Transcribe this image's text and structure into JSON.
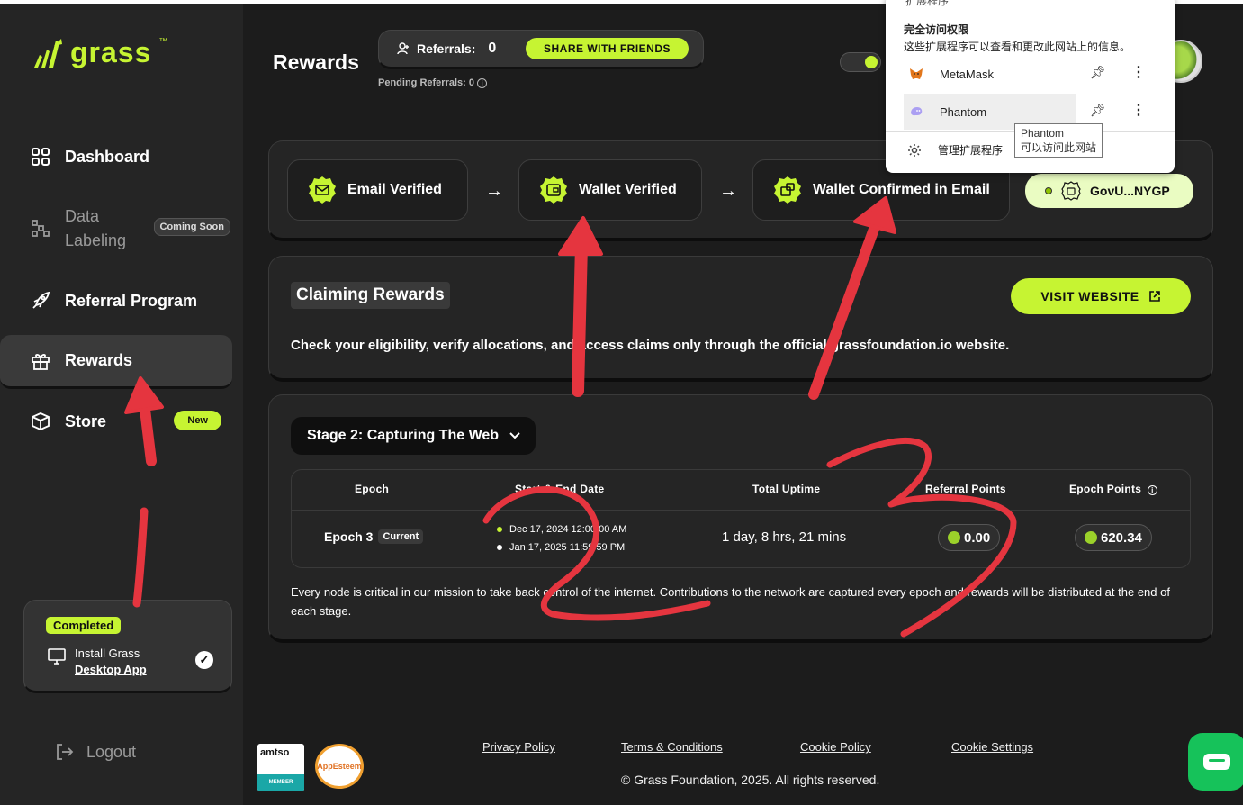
{
  "sidebar": {
    "logo_text": "grass",
    "logo_tm": "™",
    "items": [
      {
        "label": "Dashboard"
      },
      {
        "label_line1": "Data",
        "label_line2": "Labeling",
        "badge": "Coming Soon"
      },
      {
        "label": "Referral Program"
      },
      {
        "label": "Rewards"
      },
      {
        "label": "Store",
        "badge": "New"
      }
    ],
    "completed": {
      "badge": "Completed",
      "line1": "Install Grass",
      "link": "Desktop App",
      "check": "✓"
    },
    "logout": "Logout"
  },
  "header": {
    "title": "Rewards",
    "referrals_label": "Referrals:",
    "referrals_count": "0",
    "share_button": "SHARE WITH FRIENDS",
    "pending_label": "Pending Referrals:",
    "pending_count": "0"
  },
  "verification": {
    "steps": [
      "Email Verified",
      "Wallet Verified",
      "Wallet Confirmed in Email"
    ],
    "arrow": "→",
    "wallet": "GovU...NYGP"
  },
  "claiming": {
    "title": "Claiming Rewards",
    "button": "VISIT WEBSITE",
    "description": "Check your eligibility, verify allocations, and access claims only through the official grassfoundation.io website."
  },
  "stage": {
    "selector": "Stage 2: Capturing The Web",
    "columns": [
      "Epoch",
      "Start & End Date",
      "Total Uptime",
      "Referral Points",
      "Epoch Points"
    ],
    "rows": [
      {
        "epoch": "Epoch 3",
        "badge": "Current",
        "start": "Dec 17, 2024 12:00:00 AM",
        "end": "Jan 17, 2025 11:59:59 PM",
        "uptime": "1 day, 8 hrs, 21 mins",
        "referral_points": "0.00",
        "epoch_points": "620.34"
      }
    ],
    "note": "Every node is critical in our mission to take back control of the internet. Contributions to the network are captured every epoch and rewards will be distributed at the end of each stage."
  },
  "footer": {
    "links": [
      "Privacy Policy",
      "Terms & Conditions",
      "Cookie Policy",
      "Cookie Settings"
    ],
    "copyright": "© Grass Foundation, 2025. All rights reserved.",
    "amtso": "amtso",
    "amtso_member": "MEMBER",
    "appesteem": "AppEsteem"
  },
  "extensions_popup": {
    "header": "扩展程序",
    "title": "完全访问权限",
    "description": "这些扩展程序可以查看和更改此网站上的信息。",
    "items": [
      "MetaMask",
      "Phantom"
    ],
    "manage": "管理扩展程序",
    "tooltip_line1": "Phantom",
    "tooltip_line2": "可以访问此网站"
  },
  "annotations": [
    "1",
    "2",
    "3"
  ],
  "colors": {
    "accent": "#c6f432",
    "background": "#1c1c1c",
    "panel": "#252525",
    "annotation": "#e5353f"
  }
}
